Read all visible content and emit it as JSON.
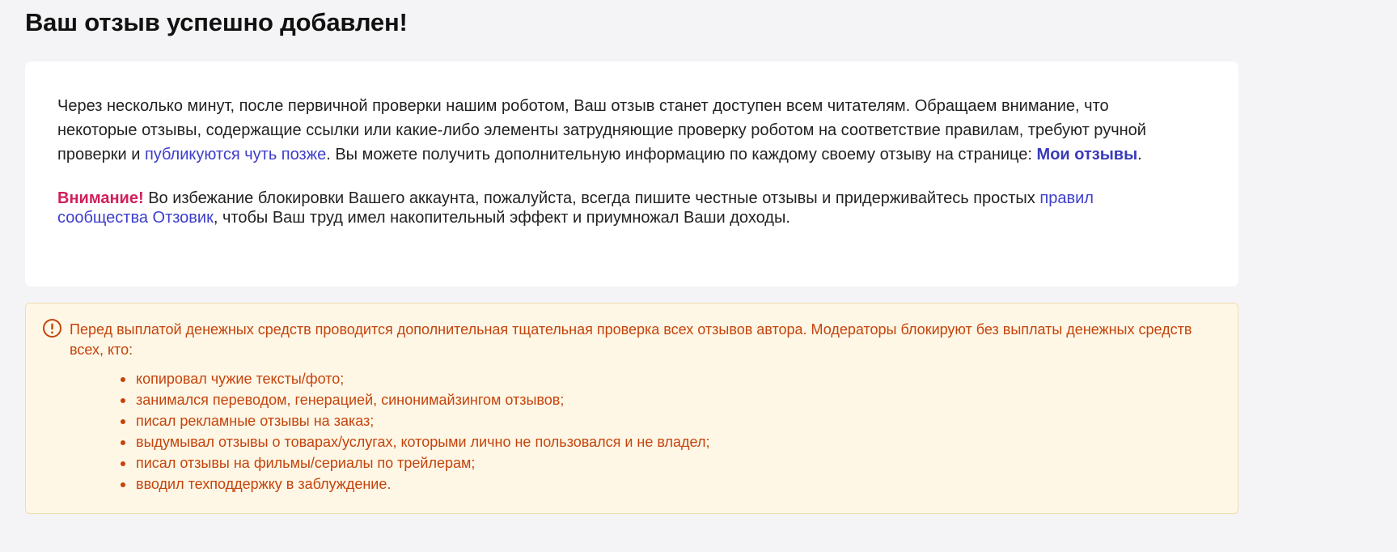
{
  "page": {
    "title": "Ваш отзыв успешно добавлен!"
  },
  "info": {
    "paragraph1_part1": "Через несколько минут, после первичной проверки нашим роботом, Ваш отзыв станет доступен всем читателям. Обращаем внимание, что некоторые отзывы, содержащие ссылки или какие-либо элементы затрудняющие проверку роботом на соответствие правилам, требуют ручной проверки и ",
    "later_link": "публикуются чуть позже",
    "paragraph1_part2": ". Вы можете получить дополнительную информацию по каждому своему отзыву на странице: ",
    "my_reviews_link": "Мои отзывы",
    "paragraph1_end": ".",
    "attention_label": "Внимание!",
    "paragraph2_part1": " Во избежание блокировки Вашего аккаунта, пожалуйста, всегда пишите честные отзывы и придерживайтесь простых ",
    "rules_link": "правил сообщества Отзовик",
    "paragraph2_part2": ", чтобы Ваш труд имел накопительный эффект и приумножал Ваши доходы."
  },
  "alert": {
    "icon": "exclamation-circle-icon",
    "text": "Перед выплатой денежных средств проводится дополнительная тщательная проверка всех отзывов автора. Модераторы блокируют без выплаты денежных средств всех, кто:",
    "items": [
      "копировал чужие тексты/фото;",
      "занимался переводом, генерацией, синонимайзингом отзывов;",
      "писал рекламные отзывы на заказ;",
      "выдумывал отзывы о товарах/услугах, которыми лично не пользовался и не владел;",
      "писал отзывы на фильмы/сериалы по трейлерам;",
      "вводил техподдержку в заблуждение."
    ]
  },
  "colors": {
    "background": "#f4f4f6",
    "link": "#3d3dcc",
    "attention": "#d0205a",
    "alert_text": "#c4440c",
    "alert_background": "#fff7e6",
    "alert_border": "#f2dcae"
  }
}
